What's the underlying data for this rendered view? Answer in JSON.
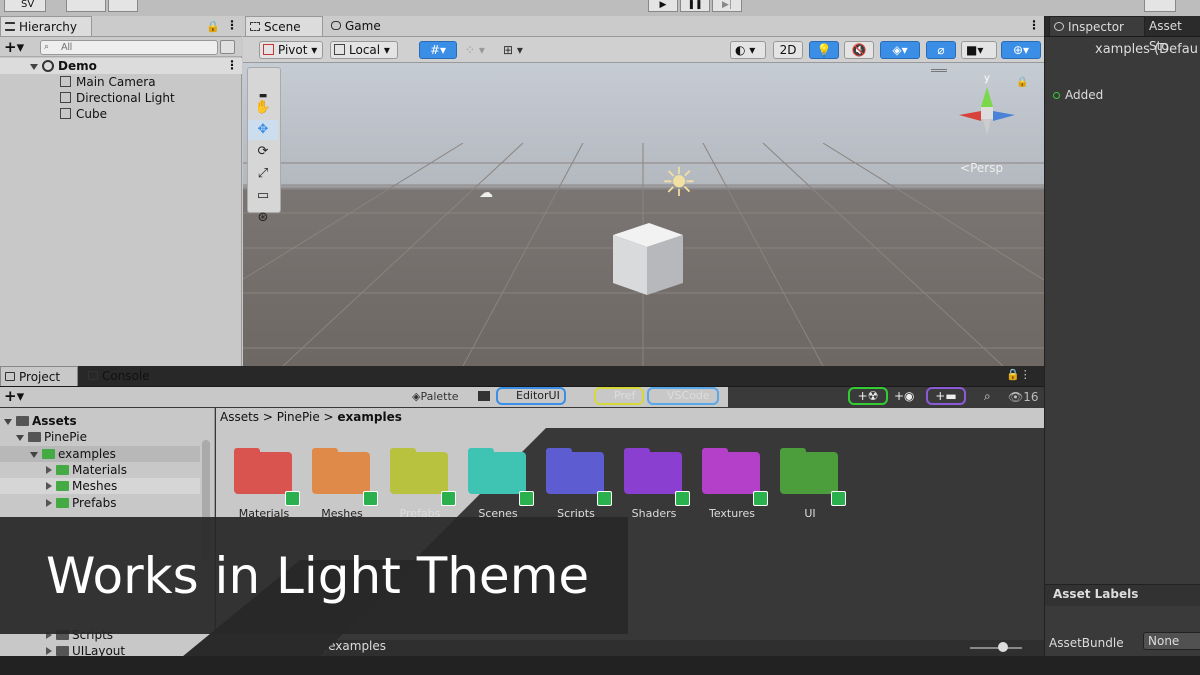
{
  "topbar": {
    "account": "SV"
  },
  "hierarchy": {
    "tab": "Hierarchy",
    "search_placeholder": "All",
    "scene": "Demo",
    "items": [
      "Main Camera",
      "Directional Light",
      "Cube"
    ]
  },
  "scene_view": {
    "tabs": [
      "Scene",
      "Game"
    ],
    "pivot": "Pivot",
    "local": "Local",
    "mode_2d": "2D",
    "persp": "Persp",
    "gizmo_axis": "y"
  },
  "inspector": {
    "tabs": [
      "Inspector",
      "Asset Sto"
    ],
    "title": "xamples (Defau",
    "added": "Added",
    "asset_labels": "Asset Labels",
    "assetbundle_label": "AssetBundle",
    "assetbundle_value": "None"
  },
  "project": {
    "tabs": [
      "Project",
      "Console"
    ],
    "toolbar_chips": [
      "Palette",
      "EditorUI",
      "Pref",
      "VSCode"
    ],
    "count": "16",
    "tree": {
      "root": "Assets",
      "pinepie": "PinePie",
      "examples": "examples",
      "children": [
        "Materials",
        "Meshes",
        "Prefabs",
        "Scripts",
        "UILayout"
      ]
    },
    "breadcrumb": [
      "Assets",
      "PinePie",
      "examples"
    ],
    "folders": [
      {
        "name": "Materials",
        "color": "#d9534f"
      },
      {
        "name": "Meshes",
        "color": "#e08a4a"
      },
      {
        "name": "Prefabs",
        "color": "#b8c23e"
      },
      {
        "name": "Scenes",
        "color": "#3fc4b4"
      },
      {
        "name": "Scripts",
        "color": "#5d5dd1"
      },
      {
        "name": "Shaders",
        "color": "#8b3fd0"
      },
      {
        "name": "Textures",
        "color": "#b43fc9"
      },
      {
        "name": "UI",
        "color": "#4c9e3c"
      }
    ],
    "path": "Assets/PinePie/examples"
  },
  "overlay": {
    "caption": "Works in Light Theme"
  }
}
